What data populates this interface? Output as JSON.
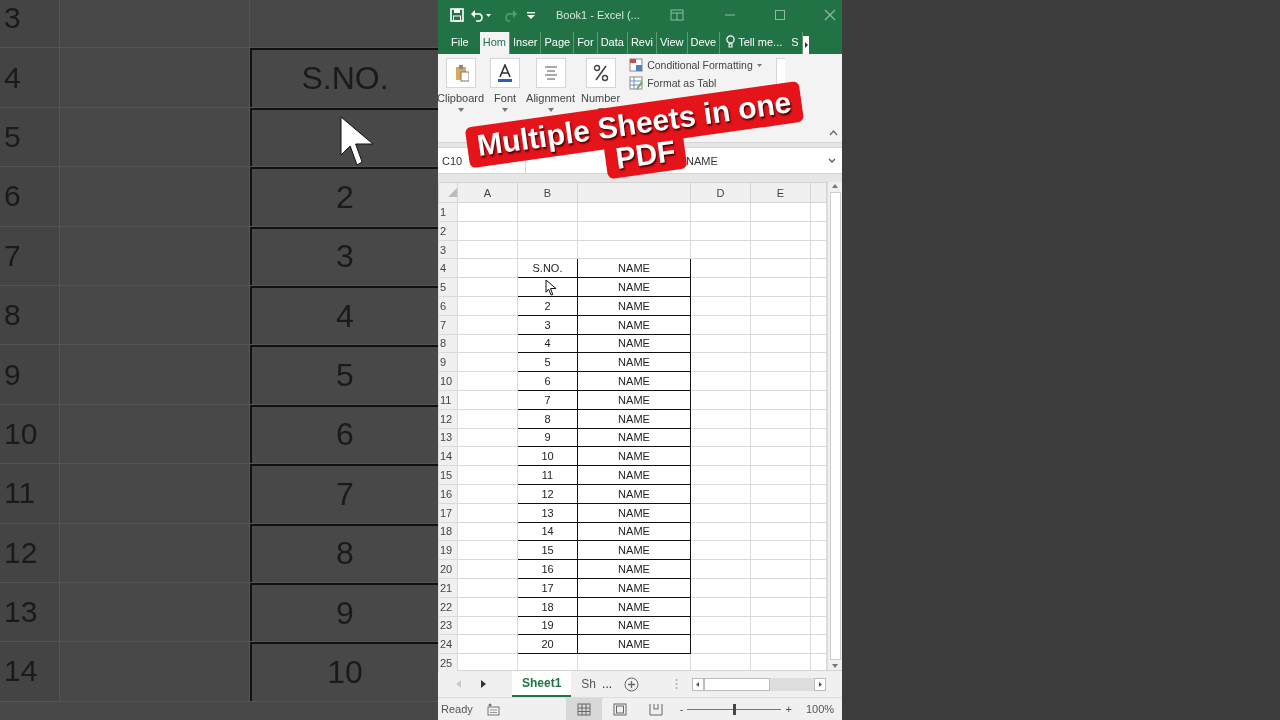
{
  "backdrop_left": {
    "rows": [
      {
        "number": "3"
      },
      {
        "number": "4",
        "cell": "S.NO."
      },
      {
        "number": "5",
        "cursor": true
      },
      {
        "number": "6",
        "cell": "2"
      },
      {
        "number": "7",
        "cell": "3"
      },
      {
        "number": "8",
        "cell": "4"
      },
      {
        "number": "9",
        "cell": "5"
      },
      {
        "number": "10",
        "cell": "6"
      },
      {
        "number": "11",
        "cell": "7"
      },
      {
        "number": "12",
        "cell": "8"
      },
      {
        "number": "13",
        "cell": "9"
      },
      {
        "number": "14",
        "cell": "10"
      }
    ]
  },
  "window": {
    "title": "Book1 - Excel (..."
  },
  "ribbon_tabs": [
    {
      "label": "File",
      "selected": false
    },
    {
      "label": "Hom",
      "selected": true
    },
    {
      "label": "Inser",
      "selected": false
    },
    {
      "label": "Page",
      "selected": false
    },
    {
      "label": "For",
      "selected": false
    },
    {
      "label": "Data",
      "selected": false
    },
    {
      "label": "Revi",
      "selected": false
    },
    {
      "label": "View",
      "selected": false
    },
    {
      "label": "Deve",
      "selected": false
    },
    {
      "label": "Tell me...",
      "kind": "search"
    },
    {
      "label": "S",
      "selected": false
    }
  ],
  "ribbon_groups": [
    {
      "label": "Clipboard",
      "kind": "paste"
    },
    {
      "label": "Font",
      "kind": "font"
    },
    {
      "label": "Alignment",
      "kind": "align"
    },
    {
      "label": "Number",
      "kind": "percent"
    }
  ],
  "styles_commands": [
    "Conditional Formatting",
    "Format as Tabl"
  ],
  "name_box": "C10",
  "formula": "NAME",
  "columns": [
    {
      "label": "A"
    },
    {
      "label": "B"
    },
    {},
    {
      "label": "D"
    },
    {
      "label": "E"
    }
  ],
  "row_numbers": [
    "1",
    "2",
    "3",
    "4",
    "5",
    "6",
    "7",
    "8",
    "9",
    "10",
    "11",
    "12",
    "13",
    "14",
    "15",
    "16",
    "17",
    "18",
    "19",
    "20",
    "21",
    "22",
    "23",
    "24",
    "25"
  ],
  "table": {
    "header": {
      "sno": "S.NO.",
      "name": "NAME"
    },
    "rows": [
      {
        "cursor": true,
        "name": "NAME"
      },
      {
        "sno": "2",
        "name": "NAME"
      },
      {
        "sno": "3",
        "name": "NAME"
      },
      {
        "sno": "4",
        "name": "NAME"
      },
      {
        "sno": "5",
        "name": "NAME"
      },
      {
        "sno": "6",
        "name": "NAME"
      },
      {
        "sno": "7",
        "name": "NAME"
      },
      {
        "sno": "8",
        "name": "NAME"
      },
      {
        "sno": "9",
        "name": "NAME"
      },
      {
        "sno": "10",
        "name": "NAME"
      },
      {
        "sno": "11",
        "name": "NAME"
      },
      {
        "sno": "12",
        "name": "NAME"
      },
      {
        "sno": "13",
        "name": "NAME"
      },
      {
        "sno": "14",
        "name": "NAME"
      },
      {
        "sno": "15",
        "name": "NAME"
      },
      {
        "sno": "16",
        "name": "NAME"
      },
      {
        "sno": "17",
        "name": "NAME"
      },
      {
        "sno": "18",
        "name": "NAME"
      },
      {
        "sno": "19",
        "name": "NAME"
      },
      {
        "sno": "20",
        "name": "NAME"
      }
    ]
  },
  "sheet_tabs": [
    {
      "label": "Sheet1",
      "selected": true
    },
    {
      "label": "Sh",
      "selected": false
    }
  ],
  "sheet_more": "...",
  "status_bar": {
    "text": "Ready",
    "views": [
      {
        "kind": "normal",
        "selected": true
      },
      {
        "kind": "layout",
        "selected": false
      },
      {
        "kind": "break",
        "selected": false
      }
    ],
    "zoom": {
      "out": "-",
      "level": 0.5,
      "in": "+",
      "reading": "100%"
    }
  },
  "overlay_title": {
    "lines": [
      "Multiple Sheets in one",
      "PDF"
    ]
  }
}
